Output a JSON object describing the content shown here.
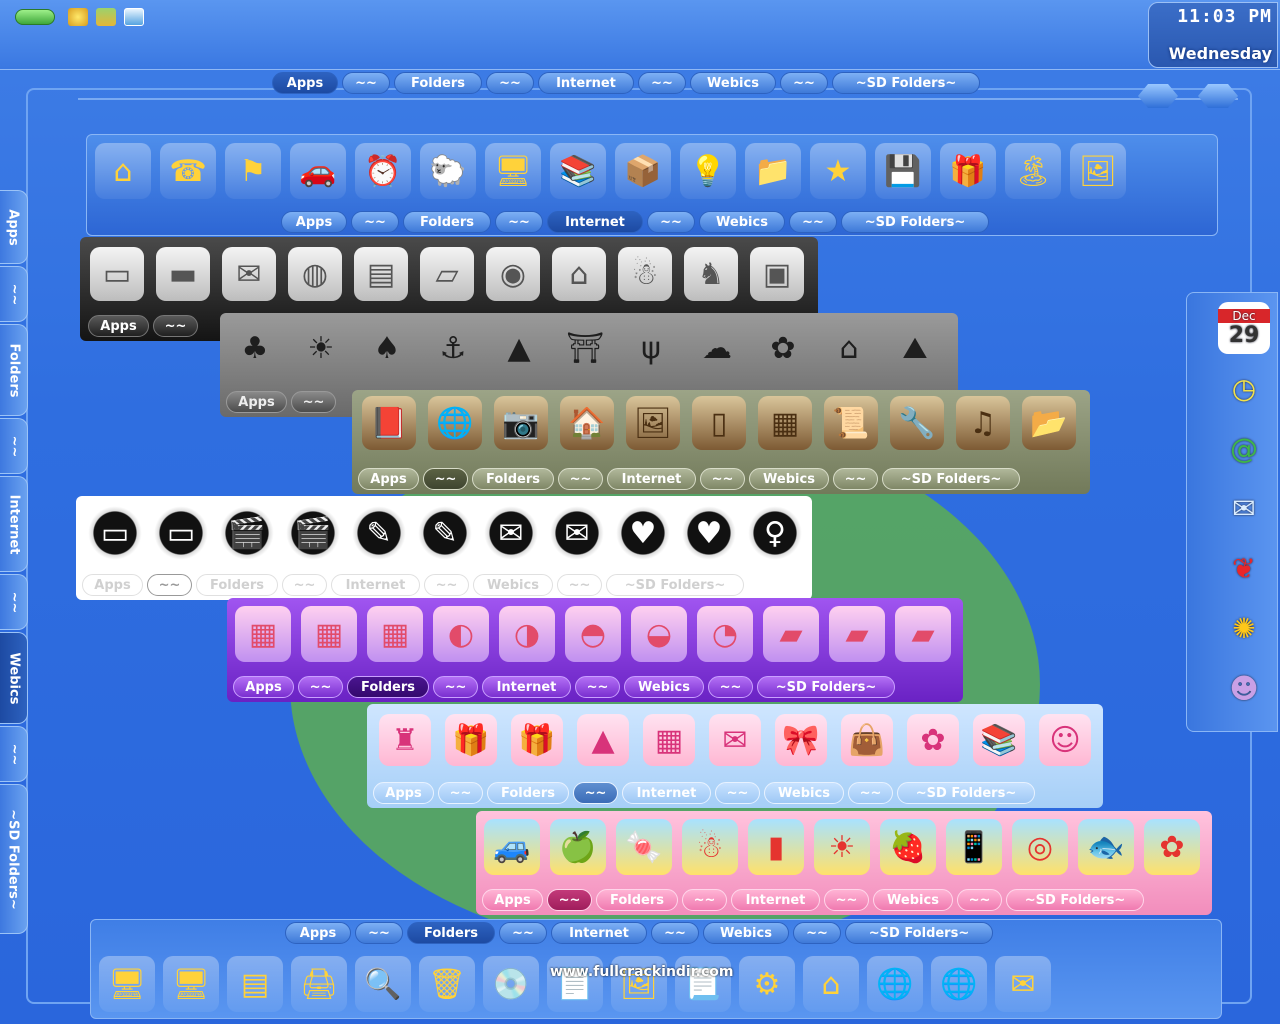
{
  "clock": {
    "time": "11:03 PM",
    "day": "Wednesday"
  },
  "tab_labels": [
    "Apps",
    "~~",
    "Folders",
    "~~",
    "Internet",
    "~~",
    "Webics",
    "~~",
    "~SD Folders~"
  ],
  "top_tabs": {
    "labels": [
      "Apps",
      "~~",
      "Folders",
      "~~",
      "Internet",
      "~~",
      "Webics",
      "~~",
      "~SD Folders~"
    ],
    "active": 0
  },
  "docks": [
    {
      "name": "blue-glossy-dock",
      "theme": "blue",
      "active": 4,
      "labels": [
        "Apps",
        "~~",
        "Folders",
        "~~",
        "Internet",
        "~~",
        "Webics",
        "~~",
        "~SD Folders~"
      ],
      "icons": [
        "house-icon",
        "address-book-icon",
        "flag-icon",
        "toy-car-icon",
        "alarm-clock-icon",
        "sheep-icon",
        "computer-icon",
        "books-icon",
        "box-house-icon",
        "lightbulb-icon",
        "folder-photo-icon",
        "star-icon",
        "floppy-icon",
        "gift-house-icon",
        "island-icon",
        "photos-icon"
      ]
    },
    {
      "name": "dark-device-dock",
      "theme": "dark",
      "active": -1,
      "labels": [
        "Apps",
        "~~"
      ],
      "icons": [
        "ipod-icon",
        "hard-drive-icon",
        "mail-icon",
        "globe-drive-icon",
        "drive-icon",
        "tablet-icon",
        "speaker-icon",
        "home-icon",
        "marshmallow-icon",
        "dog-icon",
        "apple-panel-icon"
      ]
    },
    {
      "name": "ink-landscape-dock",
      "theme": "ink",
      "active": -1,
      "labels": [
        "Apps",
        "~~"
      ],
      "icons": [
        "bonsai-icon",
        "sun-icon",
        "tree-icon",
        "fisherman-icon",
        "mountain-icon",
        "pagoda-icon",
        "bare-tree-icon",
        "cloud-icon",
        "flower-icon",
        "temple-icon",
        "peaks-icon"
      ]
    },
    {
      "name": "olive-vintage-dock",
      "theme": "olive",
      "active": 1,
      "labels": [
        "Apps",
        "~~",
        "Folders",
        "~~",
        "Internet",
        "~~",
        "Webics",
        "~~",
        "~SD Folders~"
      ],
      "icons": [
        "book-icon",
        "globe-icon",
        "camera-icon",
        "cottage-icon",
        "mona-lisa-icon",
        "fridge-icon",
        "drawer-icon",
        "scroll-icon",
        "tool-folder-icon",
        "music-folder-icon",
        "open-folder-icon"
      ]
    },
    {
      "name": "white-round-dock",
      "theme": "white",
      "active": 1,
      "labels": [
        "Apps",
        "~~",
        "Folders",
        "~~",
        "Internet",
        "~~",
        "Webics",
        "~~",
        "~SD Folders~"
      ],
      "icons": [
        "monitor-icon",
        "monitor-icon",
        "film-icon",
        "film-icon",
        "pen-icon",
        "pen-icon",
        "envelope-icon",
        "envelope-icon",
        "heart-icon",
        "heart-icon",
        "person-icon"
      ]
    },
    {
      "name": "purple-fruit-dock",
      "theme": "purple",
      "active": 2,
      "labels": [
        "Apps",
        "~~",
        "Folders",
        "~~",
        "Internet",
        "~~",
        "Webics",
        "~~",
        "~SD Folders~"
      ],
      "icons": [
        "checker-folder-icon",
        "checker-folder-icon",
        "checker-folder-icon",
        "apple-slice-icon",
        "orange-slice-icon",
        "watermelon-icon",
        "grapefruit-icon",
        "lime-icon",
        "pink-folder-icon",
        "blue-folder-icon",
        "yellow-folder-icon"
      ]
    },
    {
      "name": "light-party-dock",
      "theme": "light",
      "active": 3,
      "labels": [
        "Apps",
        "~~",
        "Folders",
        "~~",
        "Internet",
        "~~",
        "Webics",
        "~~",
        "~SD Folders~"
      ],
      "icons": [
        "chair-icon",
        "gifts-icon",
        "gift-icon",
        "party-hats-icon",
        "calendar-icon",
        "card-icon",
        "present-icon",
        "shopping-bag-icon",
        "flower-icon",
        "books-icon",
        "kids-icon"
      ]
    },
    {
      "name": "pink-candy-dock",
      "theme": "pink",
      "active": 1,
      "labels": [
        "Apps",
        "~~",
        "Folders",
        "~~",
        "Internet",
        "~~",
        "Webics",
        "~~",
        "~SD Folders~"
      ],
      "icons": [
        "jelly-car-icon",
        "jelly-apple-icon",
        "candy-bag-icon",
        "gingerbread-icon",
        "popsicle-icon",
        "sun-icon",
        "strawberry-icon",
        "phone-icon",
        "donut-icon",
        "fish-icon",
        "flower-icon"
      ]
    },
    {
      "name": "bottom-blue-dock",
      "theme": "blue",
      "active": 2,
      "labels": [
        "Apps",
        "~~",
        "Folders",
        "~~",
        "Internet",
        "~~",
        "Webics",
        "~~",
        "~SD Folders~"
      ],
      "icons": [
        "desktop-icon",
        "computer-icon",
        "drive-icon",
        "printer-icon",
        "search-icon",
        "recycle-bin-icon",
        "cd-icon",
        "document-icon",
        "image-icon",
        "html-icon",
        "settings-icon",
        "home-icon",
        "network-icon",
        "globe-icon",
        "envelope-icon"
      ]
    }
  ],
  "left_tabs": {
    "labels": [
      "Apps",
      "~~",
      "Folders",
      "~~",
      "Internet",
      "~~",
      "Webics",
      "~~",
      "~SD Folders~"
    ],
    "active": 6
  },
  "right_dock": {
    "icons": [
      "calendar-icon",
      "clock-icon",
      "email-book-icon",
      "mail-cloud-icon",
      "butterfly-icon",
      "sunflower-icon",
      "monster-icon"
    ],
    "calendar_month": "Dec",
    "calendar_day": "29"
  },
  "watermark": "www.fullcrackindir.com"
}
